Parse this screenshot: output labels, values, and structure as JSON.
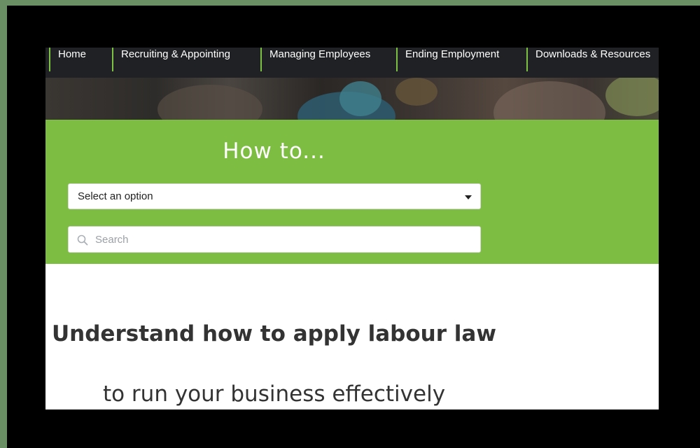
{
  "nav": {
    "items": [
      {
        "label": "Home"
      },
      {
        "label": "Recruiting & Appointing"
      },
      {
        "label": "Managing Employees"
      },
      {
        "label": "Ending Employment"
      },
      {
        "label": "Downloads & Resources"
      }
    ]
  },
  "howto": {
    "title": "How to...",
    "select_value": "Select an option",
    "search_placeholder": "Search"
  },
  "hero_text": {
    "headline": "Understand how to apply labour law",
    "subline": "to run your business effectively"
  },
  "colors": {
    "accent_green": "#7dbd41",
    "nav_background": "#1f2124",
    "outer_background": "#6a8f64"
  },
  "icons": {
    "search": "search-icon",
    "dropdown": "caret-down-icon"
  }
}
